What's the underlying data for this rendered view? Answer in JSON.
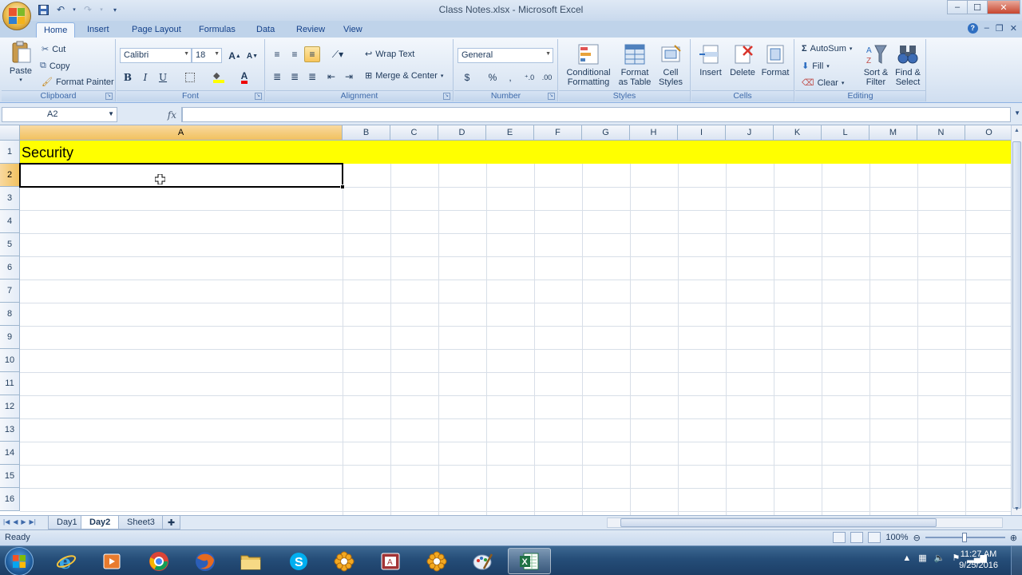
{
  "window": {
    "title": "Class Notes.xlsx - Microsoft Excel",
    "controls": {
      "minimize": "–",
      "maximize": "☐",
      "close": "✕"
    }
  },
  "ribbon_tabs": [
    "Home",
    "Insert",
    "Page Layout",
    "Formulas",
    "Data",
    "Review",
    "View"
  ],
  "active_tab": "Home",
  "clipboard": {
    "paste": "Paste",
    "cut": "Cut",
    "copy": "Copy",
    "format_painter": "Format Painter",
    "label": "Clipboard"
  },
  "font": {
    "name": "Calibri",
    "size": "18",
    "bold": "B",
    "italic": "I",
    "underline": "U",
    "label": "Font"
  },
  "alignment": {
    "wrap_text": "Wrap Text",
    "merge_center": "Merge & Center",
    "label": "Alignment"
  },
  "number": {
    "format": "General",
    "currency": "$",
    "percent": "%",
    "comma": ",",
    "label": "Number"
  },
  "styles": {
    "conditional": [
      "Conditional",
      "Formatting"
    ],
    "format_table": [
      "Format",
      "as Table"
    ],
    "cell_styles": [
      "Cell",
      "Styles"
    ],
    "label": "Styles"
  },
  "cells_group": {
    "insert": "Insert",
    "delete": "Delete",
    "format": "Format",
    "label": "Cells"
  },
  "editing": {
    "autosum": "AutoSum",
    "fill": "Fill",
    "clear": "Clear",
    "sort_filter": [
      "Sort &",
      "Filter"
    ],
    "find_select": [
      "Find &",
      "Select"
    ],
    "label": "Editing"
  },
  "formula_bar": {
    "name_box": "A2",
    "fx": "fx",
    "value": ""
  },
  "columns": [
    "A",
    "B",
    "C",
    "D",
    "E",
    "F",
    "G",
    "H",
    "I",
    "J",
    "K",
    "L",
    "M",
    "N",
    "O"
  ],
  "rows": [
    "1",
    "2",
    "3",
    "4",
    "5",
    "6",
    "7",
    "8",
    "9",
    "10",
    "11",
    "12",
    "13",
    "14",
    "15",
    "16"
  ],
  "active_cell": {
    "col": "A",
    "row": "2"
  },
  "cells": {
    "A1": "Security"
  },
  "row_fill": {
    "row": "1",
    "color": "#ffff00"
  },
  "sheets": [
    "Day1",
    "Day2",
    "Sheet3"
  ],
  "active_sheet": "Day2",
  "status": {
    "text": "Ready",
    "zoom": "100%"
  },
  "taskbar": {
    "apps": [
      "ie-icon",
      "media-icon",
      "chrome-icon",
      "firefox-icon",
      "explorer-icon",
      "skype-icon",
      "flower-icon",
      "access-icon",
      "flower-icon-2",
      "paint-icon",
      "excel-icon"
    ],
    "time": "11:27 AM",
    "date": "9/25/2016"
  }
}
